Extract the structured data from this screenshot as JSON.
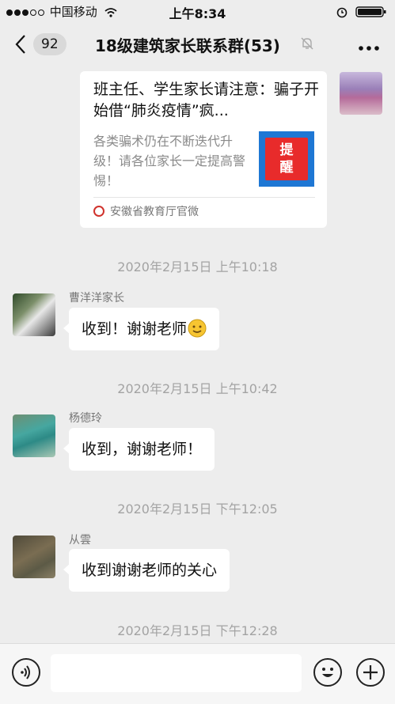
{
  "status_bar": {
    "carrier": "中国移动",
    "time": "上午8:34"
  },
  "nav": {
    "unread_count": "92",
    "title": "18级建筑家长联系群(53)"
  },
  "icons": {
    "back": "chevron-left-icon",
    "mute": "bell-muted-icon",
    "more": "more-icon",
    "voice": "voice-icon",
    "emoji": "emoji-icon",
    "plus": "plus-icon"
  },
  "article_card": {
    "title": "班主任、学生家长请注意：骗子开始借“肺炎疫情”疯...",
    "description": "各类骗术仍在不断迭代升级！请各位家长一定提高警惕！",
    "thumb_text": "提醒",
    "source": "安徽省教育厅官微"
  },
  "messages": [
    {
      "time": "2020年2月15日 上午10:18",
      "sender": "曹洋洋家长",
      "text": "收到！谢谢老师"
    },
    {
      "time": "2020年2月15日 上午10:42",
      "sender": "杨德玲",
      "text": "收到，谢谢老师！"
    },
    {
      "time": "2020年2月15日 下午12:05",
      "sender": "从雲",
      "text": "收到谢谢老师的关心"
    },
    {
      "time": "2020年2月15日 下午12:28"
    }
  ],
  "colors": {
    "background": "#ededed",
    "bubble": "#ffffff",
    "thumb_blue": "#1e77d4",
    "thumb_red": "#e82b2b"
  }
}
